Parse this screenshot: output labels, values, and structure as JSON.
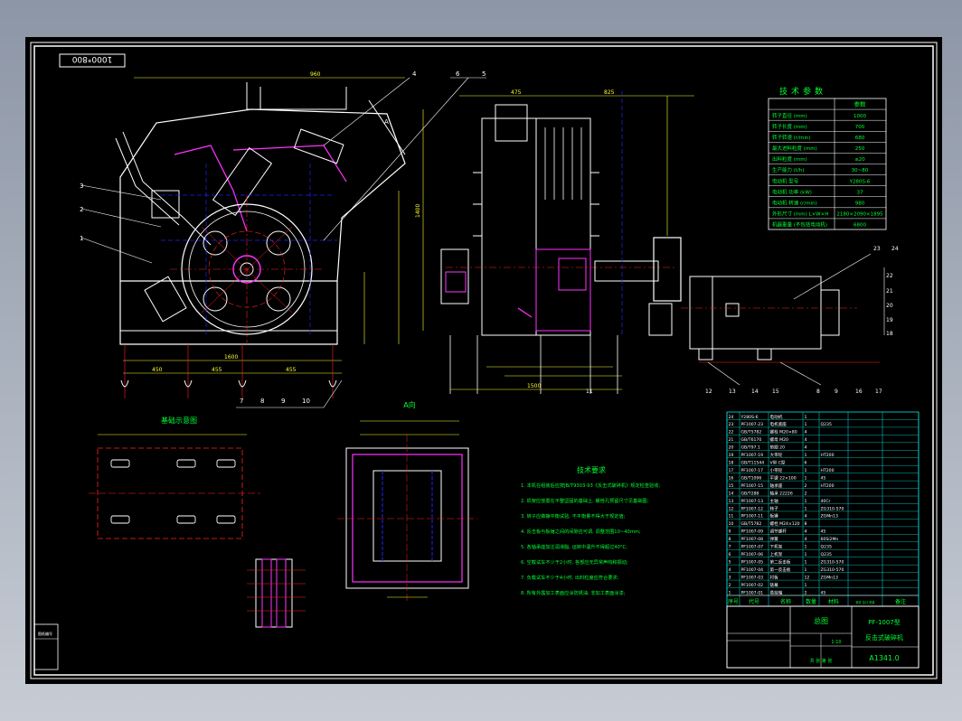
{
  "title_tag": "1000*800",
  "colors": {
    "background": "#000000",
    "outline": "#ffffff",
    "hidden": "#2222ff",
    "centerline": "#ff2222",
    "text": "#00ff33",
    "dimension": "#ffff33",
    "accent": "#ff33ff",
    "table_grid": "#00e5e5"
  },
  "views": {
    "front_section_marker": "A",
    "foundation_title": "基础示意图",
    "top_view_title": "A向"
  },
  "balloons_left": [
    "3",
    "2",
    "1"
  ],
  "balloons_bottom_left": [
    "7",
    "8",
    "9",
    "10"
  ],
  "balloons_top": [
    "4",
    "5",
    "6"
  ],
  "balloons_bottom_right": [
    "11",
    "12",
    "13",
    "14",
    "15",
    "8",
    "9",
    "16",
    "17"
  ],
  "balloons_right": [
    "23",
    "24",
    "22",
    "21",
    "20",
    "19",
    "18"
  ],
  "dims": {
    "overall_width": "1600",
    "dim_a": "450",
    "dim_b": "455",
    "dim_c": "455",
    "height": "1400",
    "top_left": "960",
    "side_top": "1500",
    "side_a": "475",
    "side_b": "825"
  },
  "params_table": {
    "title": "技术参数",
    "header": [
      "",
      "参数"
    ],
    "rows": [
      [
        "转子直径 (mm)",
        "1000"
      ],
      [
        "转子长度 (mm)",
        "700"
      ],
      [
        "转子转速 (r/min)",
        "680"
      ],
      [
        "最大进料粒度 (mm)",
        "250"
      ],
      [
        "出料粒度 (mm)",
        "≤20"
      ],
      [
        "生产能力 (t/h)",
        "30~80"
      ],
      [
        "电动机 型号",
        "Y280S-6"
      ],
      [
        "电动机 功率 (kW)",
        "37"
      ],
      [
        "电动机 转速 (r/min)",
        "980"
      ],
      [
        "外形尺寸 (mm) L×W×H",
        "2180×2090×1895"
      ],
      [
        "机器重量 (不包括电动机)",
        "6800"
      ]
    ]
  },
  "tech_req": {
    "title": "技术要求",
    "items": [
      "1. 本机在组装后应按JB/T9303-93《反击式破碎机》规定检查验收;",
      "2. 机架应放置在平整坚固的基础上, 螺栓孔预留尺寸见基础图;",
      "3. 转子应做静平衡试验, 不平衡量不得大于规定值;",
      "4. 反击板与板锤之间的间隙应可调, 调整范围10~40mm;",
      "5. 各轴承座加注润滑脂, 运转中温升不得超过40°C;",
      "6. 空载试车不少于2小时, 各部应无异常声响和振动;",
      "7. 负载试车不少于4小时, 出料粒度应符合要求;",
      "8. 所有外露加工表面应涂防锈油, 非加工表面涂漆;"
    ]
  },
  "bom": {
    "header": [
      "序号",
      "代号",
      "名称",
      "数量",
      "材料",
      "单件 总计 重量",
      "备注"
    ],
    "rows": [
      [
        "24",
        "Y280S-6",
        "电动机",
        "1",
        "",
        "",
        ""
      ],
      [
        "23",
        "PF1007-23",
        "电机底座",
        "1",
        "Q235",
        "",
        ""
      ],
      [
        "22",
        "GB/T5782",
        "螺栓 M20×80",
        "4",
        "",
        "",
        ""
      ],
      [
        "21",
        "GB/T6170",
        "螺母 M20",
        "4",
        "",
        "",
        ""
      ],
      [
        "20",
        "GB/T97.1",
        "垫圈 20",
        "4",
        "",
        "",
        ""
      ],
      [
        "19",
        "PF1007-19",
        "大带轮",
        "1",
        "HT200",
        "",
        ""
      ],
      [
        "18",
        "GB/T11544",
        "V带 C型",
        "6",
        "",
        "",
        ""
      ],
      [
        "17",
        "PF1007-17",
        "小带轮",
        "1",
        "HT200",
        "",
        ""
      ],
      [
        "16",
        "GB/T1096",
        "平键 22×100",
        "1",
        "45",
        "",
        ""
      ],
      [
        "15",
        "PF1007-15",
        "轴承座",
        "2",
        "HT200",
        "",
        ""
      ],
      [
        "14",
        "GB/T288",
        "轴承 22226",
        "2",
        "",
        "",
        ""
      ],
      [
        "13",
        "PF1007-13",
        "主轴",
        "1",
        "40Cr",
        "",
        ""
      ],
      [
        "12",
        "PF1007-12",
        "转子",
        "1",
        "ZG310-570",
        "",
        ""
      ],
      [
        "11",
        "PF1007-11",
        "板锤",
        "4",
        "ZGMn13",
        "",
        ""
      ],
      [
        "10",
        "GB/T5782",
        "螺栓 M24×120",
        "8",
        "",
        "",
        ""
      ],
      [
        "9",
        "PF1007-09",
        "调节螺杆",
        "4",
        "45",
        "",
        ""
      ],
      [
        "8",
        "PF1007-08",
        "弹簧",
        "4",
        "60Si2Mn",
        "",
        ""
      ],
      [
        "7",
        "PF1007-07",
        "下机架",
        "1",
        "Q235",
        "",
        ""
      ],
      [
        "6",
        "PF1007-06",
        "上机架",
        "1",
        "Q235",
        "",
        ""
      ],
      [
        "5",
        "PF1007-05",
        "第二反击板",
        "1",
        "ZG310-570",
        "",
        ""
      ],
      [
        "4",
        "PF1007-04",
        "第一反击板",
        "1",
        "ZG310-570",
        "",
        ""
      ],
      [
        "3",
        "PF1007-03",
        "衬板",
        "12",
        "ZGMn13",
        "",
        ""
      ],
      [
        "2",
        "PF1007-02",
        "链幕",
        "1",
        "",
        "",
        ""
      ],
      [
        "1",
        "PF1007-01",
        "悬挂轴",
        "2",
        "45",
        "",
        ""
      ]
    ]
  },
  "title_block": {
    "drawing_name": "总图",
    "model": "PF-1007型",
    "product": "反击式破碎机",
    "drawing_no": "A1341.0",
    "scale": "1:10",
    "sheets": "共 张 第 张"
  },
  "side_label": "图纸编号"
}
